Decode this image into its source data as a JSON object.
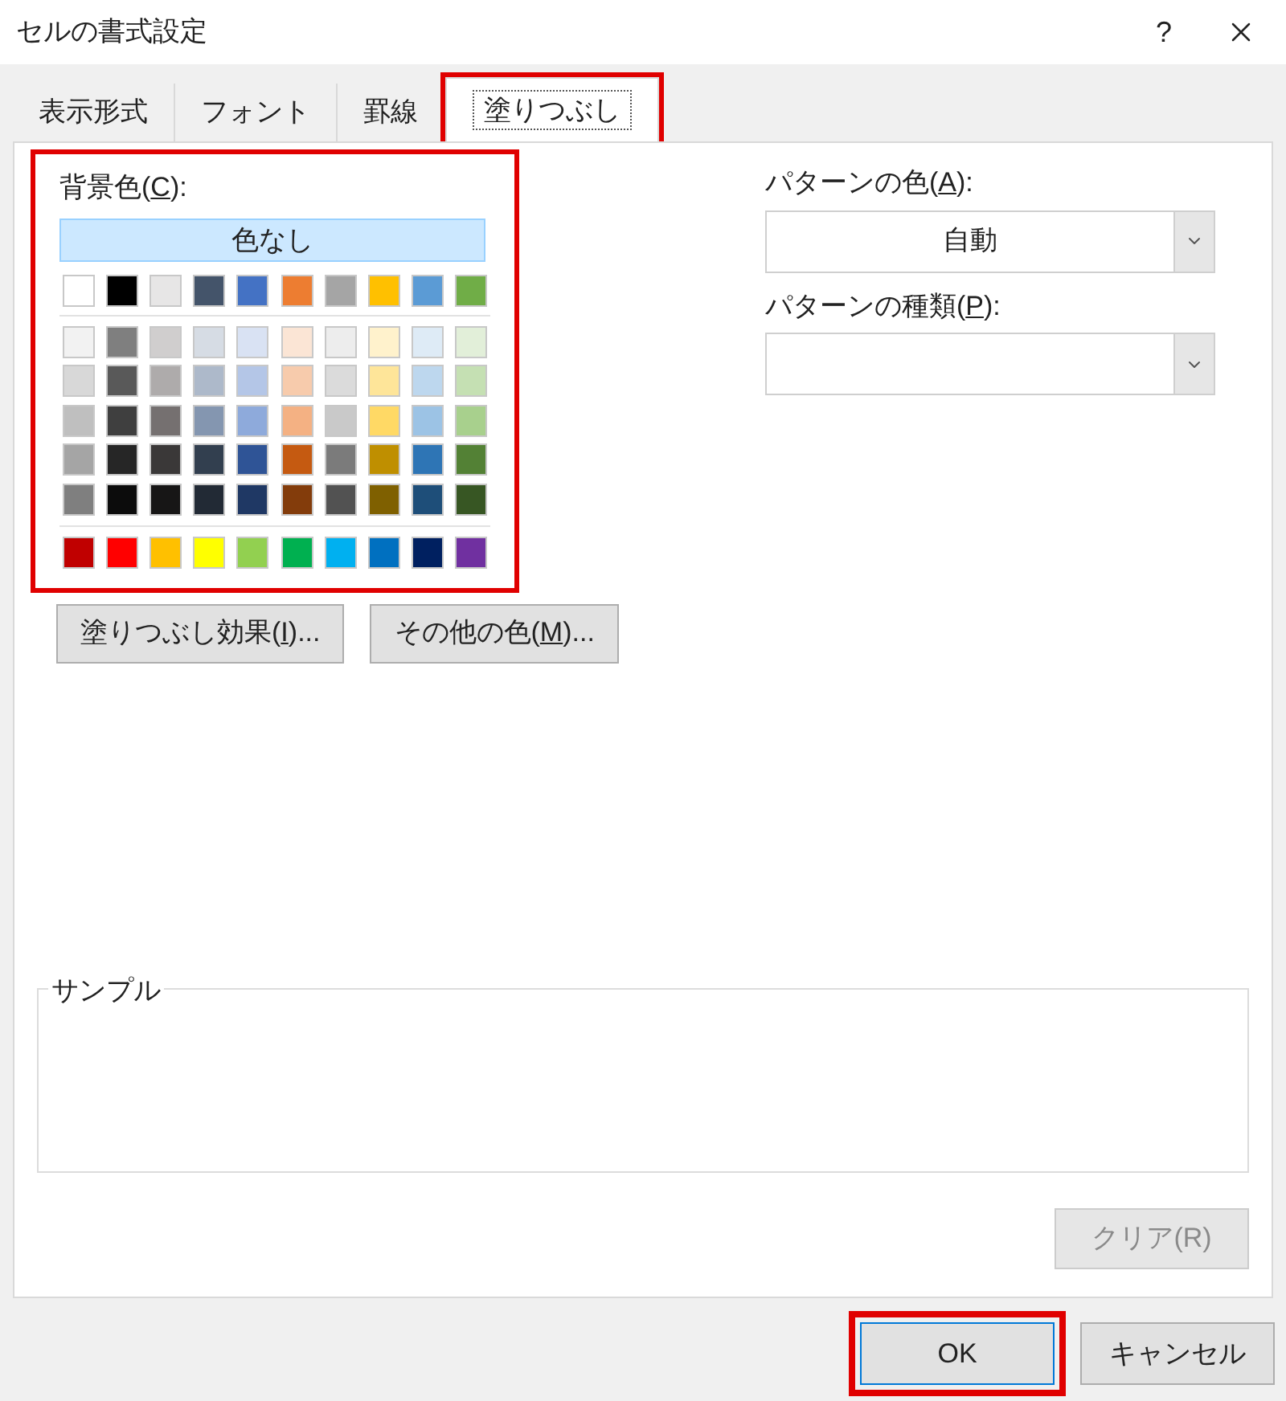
{
  "window": {
    "title": "セルの書式設定",
    "help": "?"
  },
  "tabs": [
    {
      "label": "表示形式",
      "selected": false,
      "highlighted": false
    },
    {
      "label": "フォント",
      "selected": false,
      "highlighted": false
    },
    {
      "label": "罫線",
      "selected": false,
      "highlighted": false
    },
    {
      "label": "塗りつぶし",
      "selected": true,
      "highlighted": true
    }
  ],
  "background_color": {
    "label_parts": [
      "背景色(",
      "C",
      "):"
    ],
    "highlighted": true,
    "no_color": {
      "label": "色なし",
      "selected": true
    },
    "theme_colors": [
      {
        "color": "#ffffff"
      },
      {
        "color": "#000000"
      },
      {
        "color": "#e7e6e6"
      },
      {
        "color": "#44546a"
      },
      {
        "color": "#4472c4"
      },
      {
        "color": "#ed7d31"
      },
      {
        "color": "#a5a5a5"
      },
      {
        "color": "#ffc000"
      },
      {
        "color": "#5b9bd5"
      },
      {
        "color": "#70ad47"
      }
    ],
    "tints": [
      [
        {
          "color": "#f2f2f2"
        },
        {
          "color": "#7f7f7f"
        },
        {
          "color": "#d0cece"
        },
        {
          "color": "#d6dce4"
        },
        {
          "color": "#d9e2f3"
        },
        {
          "color": "#fbe5d5"
        },
        {
          "color": "#ededed"
        },
        {
          "color": "#fff2cc"
        },
        {
          "color": "#deebf6"
        },
        {
          "color": "#e2efd9"
        }
      ],
      [
        {
          "color": "#d8d8d8"
        },
        {
          "color": "#595959"
        },
        {
          "color": "#aeabab"
        },
        {
          "color": "#adb9ca"
        },
        {
          "color": "#b4c6e7"
        },
        {
          "color": "#f7cbac"
        },
        {
          "color": "#dbdbdb"
        },
        {
          "color": "#fee599"
        },
        {
          "color": "#bdd7ee"
        },
        {
          "color": "#c5e0b3"
        }
      ],
      [
        {
          "color": "#bfbfbf"
        },
        {
          "color": "#3f3f3f"
        },
        {
          "color": "#757070"
        },
        {
          "color": "#8496b0"
        },
        {
          "color": "#8eaadb"
        },
        {
          "color": "#f4b183"
        },
        {
          "color": "#c9c9c9"
        },
        {
          "color": "#ffd965"
        },
        {
          "color": "#9cc3e5"
        },
        {
          "color": "#a8d08d"
        }
      ],
      [
        {
          "color": "#a5a5a5"
        },
        {
          "color": "#262626"
        },
        {
          "color": "#3a3838"
        },
        {
          "color": "#323f4f"
        },
        {
          "color": "#2f5496"
        },
        {
          "color": "#c55a11"
        },
        {
          "color": "#7b7b7b"
        },
        {
          "color": "#bf8f00"
        },
        {
          "color": "#2e75b5"
        },
        {
          "color": "#538135"
        }
      ],
      [
        {
          "color": "#7f7f7f"
        },
        {
          "color": "#0c0c0c"
        },
        {
          "color": "#171616"
        },
        {
          "color": "#222a35"
        },
        {
          "color": "#1f3864"
        },
        {
          "color": "#833c0b"
        },
        {
          "color": "#525252"
        },
        {
          "color": "#7f6000"
        },
        {
          "color": "#1e4e79"
        },
        {
          "color": "#375623"
        }
      ]
    ],
    "standard_colors": [
      {
        "color": "#c00000"
      },
      {
        "color": "#ff0000"
      },
      {
        "color": "#ffc000"
      },
      {
        "color": "#ffff00"
      },
      {
        "color": "#92d050"
      },
      {
        "color": "#00b050"
      },
      {
        "color": "#00b0f0"
      },
      {
        "color": "#0070c0"
      },
      {
        "color": "#002060"
      },
      {
        "color": "#7030a0"
      }
    ]
  },
  "action_buttons": [
    {
      "label_parts": [
        "塗りつぶし効果(",
        "I",
        ")..."
      ]
    },
    {
      "label_parts": [
        "その他の色(",
        "M",
        ")..."
      ]
    }
  ],
  "pattern_color": {
    "label_parts": [
      "パターンの色(",
      "A",
      "):"
    ],
    "value": "自動"
  },
  "pattern_style": {
    "label_parts": [
      "パターンの種類(",
      "P",
      "):"
    ]
  },
  "sample": {
    "label": "サンプル"
  },
  "clear_button": {
    "label": "クリア(R)",
    "disabled": true
  },
  "footer_buttons": [
    {
      "label": "OK",
      "default": true,
      "highlighted": true
    },
    {
      "label": "キャンセル",
      "default": false,
      "highlighted": false
    }
  ]
}
